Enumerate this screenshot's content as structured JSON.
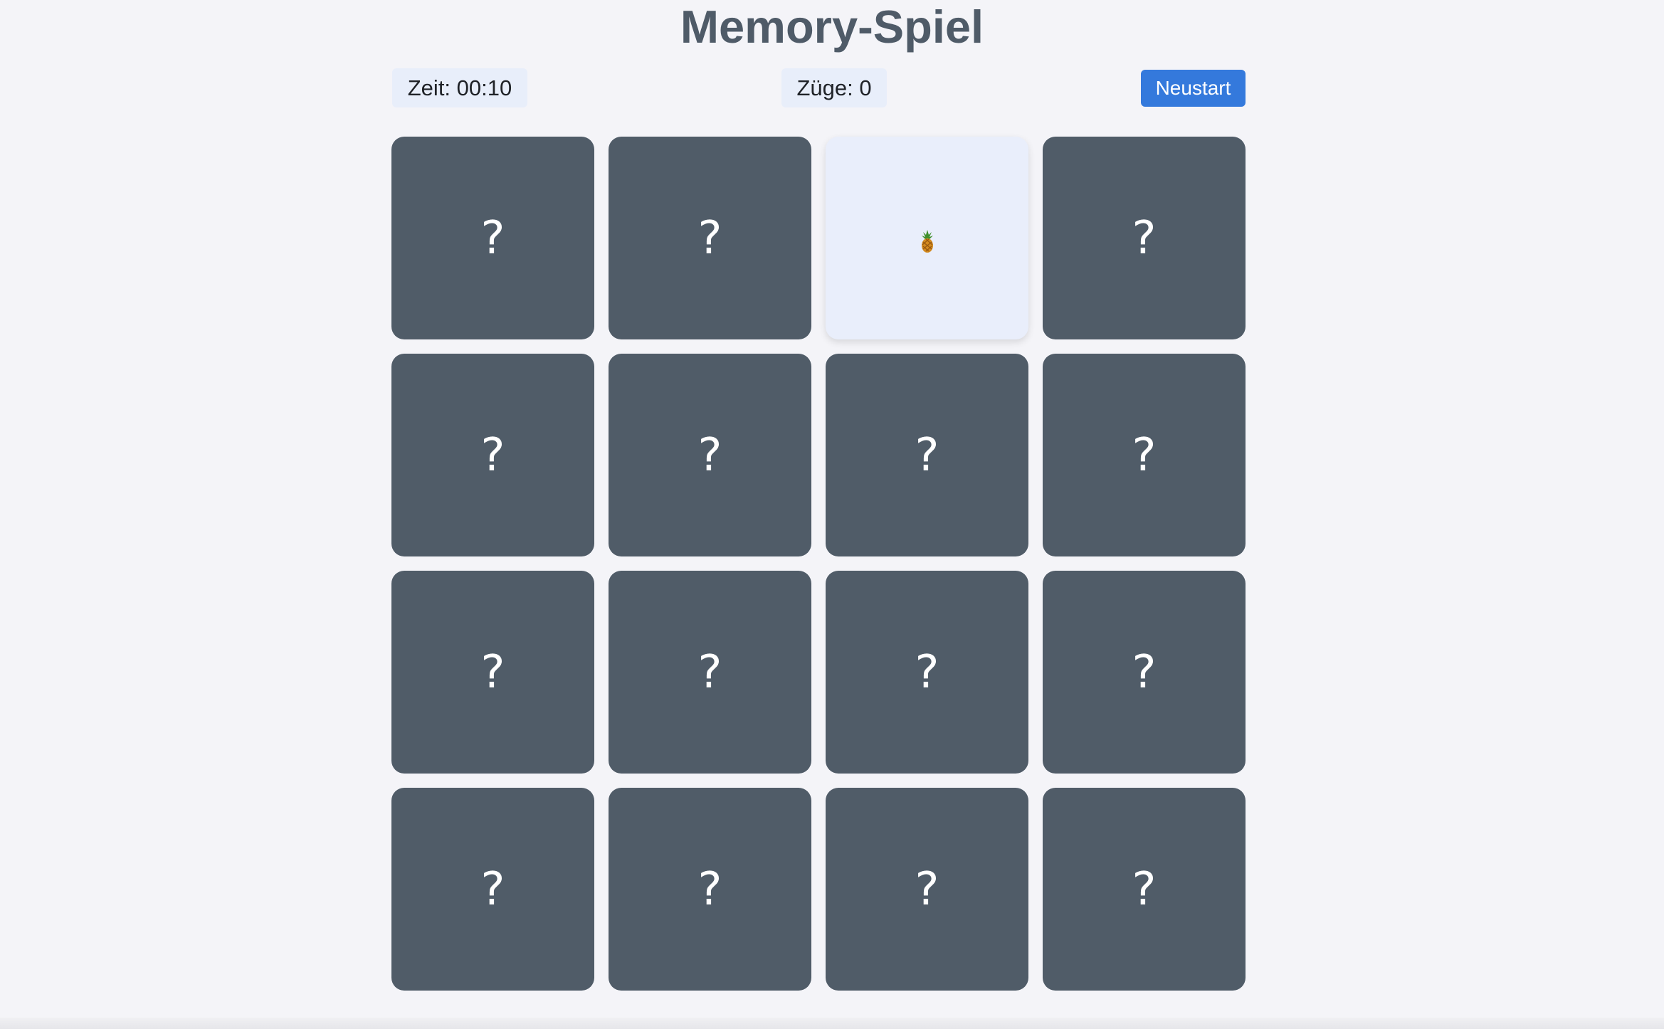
{
  "header": {
    "title": "Memory-Spiel"
  },
  "stats": {
    "time": "Zeit: 00:10",
    "moves": "Züge: 0"
  },
  "controls": {
    "restart_label": "Neustart"
  },
  "board": {
    "columns": 4,
    "rows": 4,
    "hidden_symbol": "?",
    "cards": [
      {
        "state": "hidden"
      },
      {
        "state": "hidden"
      },
      {
        "state": "revealed",
        "content": "🍍",
        "icon": "pineapple-icon"
      },
      {
        "state": "hidden"
      },
      {
        "state": "hidden"
      },
      {
        "state": "hidden"
      },
      {
        "state": "hidden"
      },
      {
        "state": "hidden"
      },
      {
        "state": "hidden"
      },
      {
        "state": "hidden"
      },
      {
        "state": "hidden"
      },
      {
        "state": "hidden"
      },
      {
        "state": "hidden"
      },
      {
        "state": "hidden"
      },
      {
        "state": "hidden"
      },
      {
        "state": "hidden"
      }
    ]
  },
  "colors": {
    "background": "#f4f4f8",
    "title": "#4f5b68",
    "card_back": "#505c68",
    "card_face": "#e9eefb",
    "stat_pill": "#e8eefa",
    "button": "#3479dc"
  }
}
